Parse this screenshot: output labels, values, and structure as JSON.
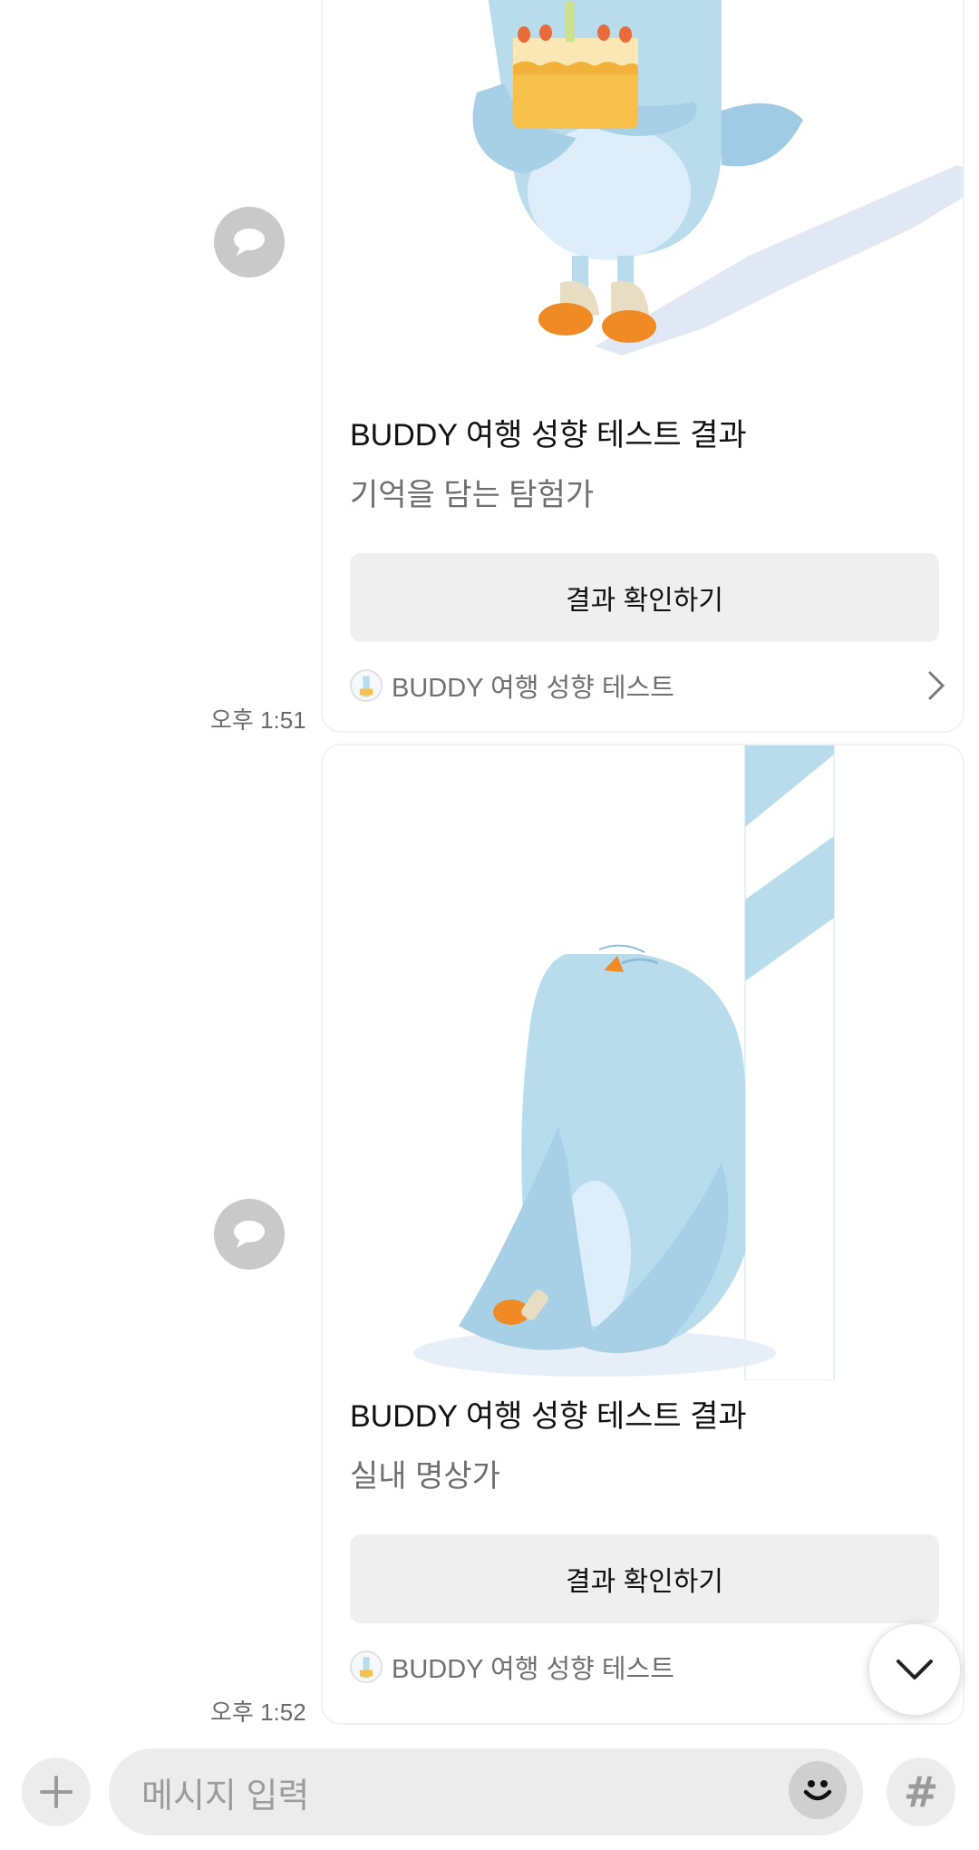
{
  "messages": [
    {
      "card_title": "BUDDY 여행 성향 테스트 결과",
      "card_desc": "기억을 담는 탐험가",
      "button_label": "결과 확인하기",
      "footer_label": "BUDDY 여행 성향 테스트",
      "time": "오후 1:51"
    },
    {
      "card_title": "BUDDY 여행 성향 테스트 결과",
      "card_desc": "실내 명상가",
      "button_label": "결과 확인하기",
      "footer_label": "BUDDY 여행 성향 테스트",
      "time": "오후 1:52"
    }
  ],
  "input": {
    "placeholder": "메시지 입력"
  },
  "icons": {
    "share": "share-speech-bubble-icon",
    "plus": "plus-icon",
    "emoji": "emoji-icon",
    "hashtag": "hashtag-icon",
    "scroll_down": "chevron-down-icon",
    "footer_chevron": "chevron-right-icon"
  },
  "colors": {
    "bird": "#b9dced",
    "accent_orange": "#f08a24",
    "button_bg": "#efefef",
    "gray_icon": "#c9c9c9"
  }
}
